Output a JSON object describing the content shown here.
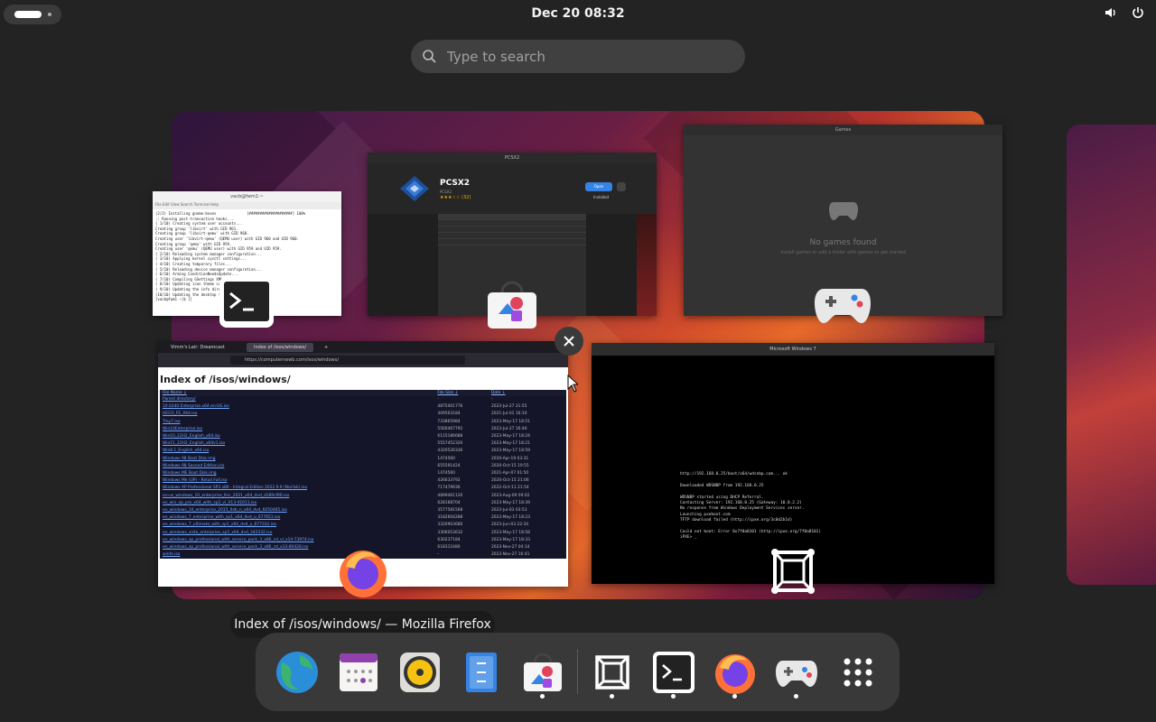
{
  "topbar": {
    "clock": "Dec 20  08:32",
    "icons": [
      "activities-indicator",
      "volume-icon",
      "power-icon"
    ]
  },
  "search": {
    "placeholder": "Type to search"
  },
  "windows": {
    "terminal": {
      "title": "vacb@fwm1:~",
      "menu": "File  Edit  View  Search  Terminal  Help",
      "lines": [
        "(2/2) Installing gnome-boxes              [####################] 100%",
        ":: Running post-transaction hooks...",
        "( 1/10) Creating system user accounts...",
        "Creating group 'libvirt' with GID 961.",
        "Creating group 'libvirt-qemu' with GID 960.",
        "Creating user 'libvirt-qemu' (QEMU user) with GID 960 and UID 960.",
        "Creating group 'qemu' with GID 959.",
        "Creating user 'qemu' (QEMU user) with GID 959 and UID 959.",
        "( 2/10) Reloading system manager configuration...",
        "( 3/10) Applying kernel sysctl settings...",
        "( 4/10) Creating temporary files...",
        "( 5/10) Reloading device manager configuration...",
        "( 6/10) Arming ConditionNeedsUpdate...",
        "( 7/10) Compiling GSettings XML schema files...",
        "( 8/10) Updating icon theme caches...",
        "( 9/10) Updating the info directory file...",
        "(10/10) Updating the desktop file MIME type cache...",
        "[vacb@fwm1 ~]$ []"
      ]
    },
    "software": {
      "title": "PCSX2",
      "app_name": "PCSX2",
      "subtitle": "PCSX2",
      "stars": "★★★☆☆ (32)",
      "open_label": "Open",
      "installed_label": "Installed"
    },
    "games": {
      "title": "Games",
      "empty_text": "No games found",
      "hint": "Install games or add a folder with games to get started"
    },
    "firefox": {
      "tabs": [
        "Vimm's Lair: Dreamcast",
        "Index of /isos/windows/",
        "+"
      ],
      "url": "https://computernewb.com/isos/windows/",
      "heading": "Index of /isos/windows/",
      "columns": [
        "File Name ↓",
        "File Size ↓",
        "Date ↓"
      ],
      "rows": [
        [
          "Parent directory/",
          "-",
          "-"
        ],
        [
          "10.0240 Enterprise.x64.en-US.iso",
          "4875401776",
          "2023-Jul-27 21:55"
        ],
        [
          "HECO_FE_X64.iso",
          "309503184",
          "2021-Jul-01 16:10"
        ],
        [
          "Tiny7.iso",
          "733865984",
          "2023-May-17 18:51"
        ],
        [
          "Win10Enterprise.iso",
          "5560467792",
          "2023-Jul-27 16:46"
        ],
        [
          "Win10_22H2_English_x64.iso",
          "6115186688",
          "2023-May-17 18:24"
        ],
        [
          "Win11_22H2_English_x64v1.iso",
          "5557452320",
          "2023-May-17 18:21"
        ],
        [
          "Win8.1_English_x64.iso",
          "4320526336",
          "2023-May-17 18:59"
        ],
        [
          "Windows 98 Boot Disk.img",
          "1474560",
          "2020-Apr-19 03:31"
        ],
        [
          "Windows 98 Second Edition.iso",
          "655591424",
          "2020-Oct-15 19:55"
        ],
        [
          "Windows ME Boot Disk.img",
          "1474560",
          "2021-Apr-07 01:50"
        ],
        [
          "Windows Me (UP) - Retail Full.iso",
          "426633792",
          "2020-Oct-15 21:06"
        ],
        [
          "Windows XP Professional SP3 x86 - Integral Edition 2022.9.9 (Norilsk).iso",
          "717479936",
          "2022-Oct-11 21:54"
        ],
        [
          "en-us_windows_10_enterprise_ltsc_2021_x64_dvd_d289cf96.iso",
          "4899461120",
          "2023-Aug-09 09:02"
        ],
        [
          "en_win_xp_pro_x64_with_sp2_vl_X13-41611.iso",
          "628168704",
          "2023-May-17 18:39"
        ],
        [
          "en_windows_10_enterprise_2015_ltsb_n_x64_dvd_6050465.iso",
          "3577581568",
          "2023-Jul-03 03:53"
        ],
        [
          "en_windows_7_enterprise_with_sp1_x64_dvd_u_677651.iso",
          "3182604288",
          "2023-May-17 18:23"
        ],
        [
          "en_windows_7_ultimate_with_sp1_x64_dvd_u_677332.iso",
          "3320903680",
          "2023-Jun-03 22:34"
        ],
        [
          "en_windows_vista_enterprise_sp2_x64_dvd_342332.iso",
          "3306053632",
          "2023-May-17 18:58"
        ],
        [
          "en_windows_xp_professional_with_service_pack_3_x86_cd_vl_x14-73974.iso",
          "630237184",
          "2023-May-17 18:33"
        ],
        [
          "en_windows_xp_professional_with_service_pack_3_x86_cd_x14-80428.iso",
          "618311680",
          "2023-Nov-27 04:14"
        ],
        [
          "winfe.iso",
          "-",
          "2023-Nov-27 16:41"
        ]
      ]
    },
    "vm": {
      "title": "Microsoft Windows 7",
      "lines": [
        "http://192.168.0.25/boot/x64/wdsnbp.com... ok",
        "",
        "Downloaded WDSNBP from 192.168.0.25",
        "",
        "WDSNBP started using DHCP Referral.",
        "Contacting Server: 192.168.0.25 (Gateway: 10.0.2.2)",
        "No response from Windows Deployment Services server.",
        "Launching pxeboot.com",
        "TFTP download failed (http://ipxe.org/3c0d2b1d)",
        "",
        "Could not boot: Error 0x7f0a8101 (http://ipxe.org/7f0a8101)",
        "iPXE> _"
      ]
    }
  },
  "tooltip": "Index of /isos/windows/ — Mozilla Firefox",
  "dock": {
    "items": [
      {
        "name": "web-browser-icon",
        "running": false
      },
      {
        "name": "calendar-icon",
        "running": false
      },
      {
        "name": "rhythmbox-icon",
        "running": false
      },
      {
        "name": "files-icon",
        "running": false
      },
      {
        "name": "software-icon",
        "running": true
      },
      {
        "name": "boxes-icon",
        "running": true
      },
      {
        "name": "terminal-icon",
        "running": true
      },
      {
        "name": "firefox-icon",
        "running": true
      },
      {
        "name": "games-icon",
        "running": true
      },
      {
        "name": "app-grid-icon",
        "running": false
      }
    ]
  },
  "colors": {
    "accent": "#3584e4",
    "panel_bg": "#232323",
    "dock_bg": "#3c3c3c",
    "link": "#6ea8ff"
  }
}
